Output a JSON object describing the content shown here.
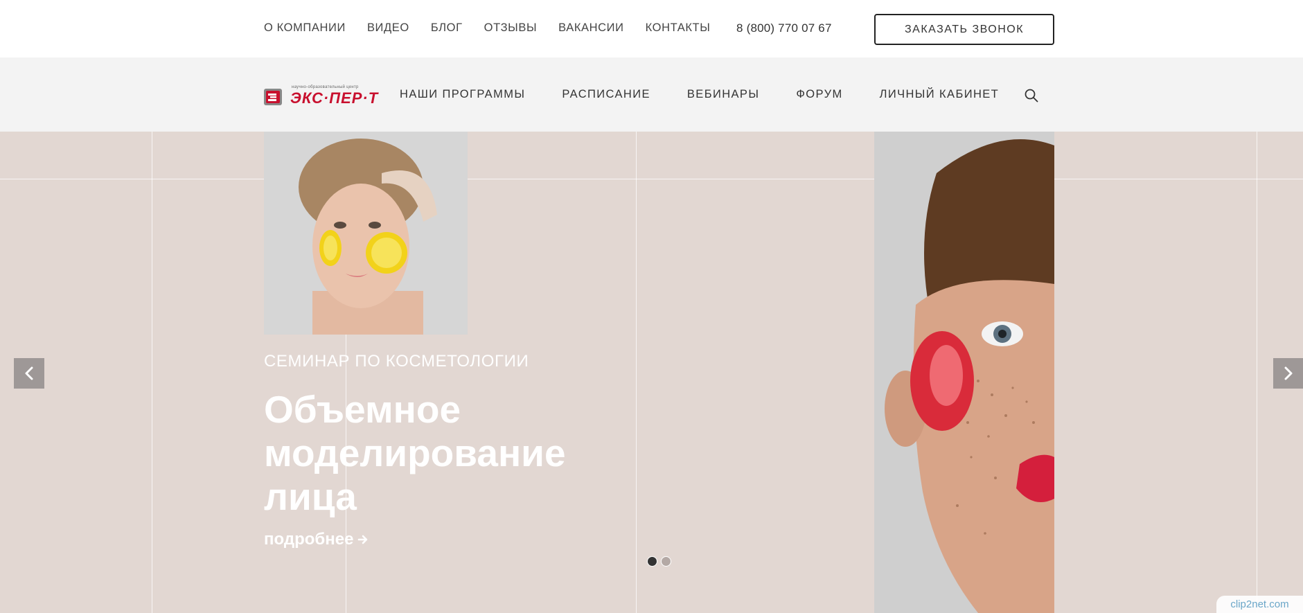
{
  "topbar": {
    "nav": [
      "О КОМПАНИИ",
      "ВИДЕО",
      "БЛОГ",
      "ОТЗЫВЫ",
      "ВАКАНСИИ",
      "КОНТАКТЫ"
    ],
    "phone": "8 (800) 770 07 67",
    "call_button": "ЗАКАЗАТЬ ЗВОНОК"
  },
  "logo": {
    "tagline": "научно-образовательный центр",
    "wordmark": "ЭКС·ПЕР·Т"
  },
  "mainnav": {
    "items": [
      "НАШИ ПРОГРАММЫ",
      "РАСПИСАНИЕ",
      "ВЕБИНАРЫ",
      "ФОРУМ",
      "ЛИЧНЫЙ КАБИНЕТ"
    ]
  },
  "hero": {
    "subtitle": "СЕМИНАР ПО КОСМЕТОЛОГИИ",
    "title_lines": [
      "Объемное",
      "моделирование",
      "лица"
    ],
    "more_link": "подробнее",
    "slides_total": 2,
    "active_slide": 1
  },
  "watermark": "clip2net.com",
  "colors": {
    "hero_bg": "#e2d7d2",
    "topbar_bg": "#ffffff",
    "mainbar_bg": "#f3f3f3",
    "brand_red": "#c8102e",
    "arrow_bg": "#9e9897"
  },
  "icons": {
    "search": "search-icon",
    "prev": "chevron-left-icon",
    "next": "chevron-right-icon",
    "more_arrow": "arrow-right-icon"
  }
}
